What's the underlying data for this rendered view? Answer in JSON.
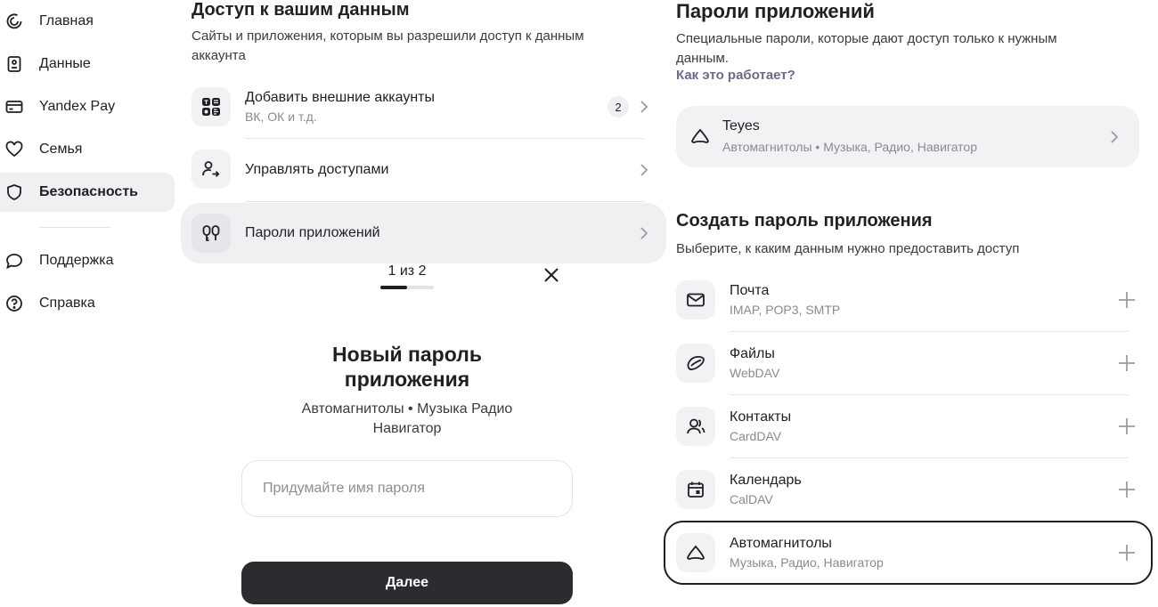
{
  "sidebar": {
    "items": [
      {
        "label": "Главная",
        "icon": "home-icon"
      },
      {
        "label": "Данные",
        "icon": "id-card-icon"
      },
      {
        "label": "Yandex Pay",
        "icon": "credit-card-icon"
      },
      {
        "label": "Семья",
        "icon": "heart-icon"
      },
      {
        "label": "Безопасность",
        "icon": "shield-icon",
        "active": true
      },
      {
        "label": "Поддержка",
        "icon": "chat-icon"
      },
      {
        "label": "Справка",
        "icon": "help-icon"
      }
    ]
  },
  "access": {
    "title": "Доступ к вашим данным",
    "subtitle_line1": "Сайты и приложения, которым вы разрешили доступ к данным",
    "subtitle_line2": "аккаунта",
    "rows": [
      {
        "title": "Добавить внешние аккаунты",
        "subtitle": "ВК, ОК и т.д.",
        "badge": "2",
        "icon": "social-apps-icon"
      },
      {
        "title": "Управлять доступами",
        "icon": "user-access-icon"
      },
      {
        "title": "Пароли приложений",
        "icon": "app-password-icon"
      }
    ]
  },
  "wizard": {
    "step_label": "1 из 2",
    "step_progress": 0.5,
    "title_line1": "Новый пароль",
    "title_line2": "приложения",
    "subtitle_line1": "Автомагнитолы • Музыка Радио",
    "subtitle_line2": "Навигатор",
    "input_placeholder": "Придумайте имя пароля",
    "next_label": "Далее"
  },
  "app_passwords": {
    "title": "Пароли приложений",
    "subtitle_line1": "Специальные пароли, которые дают доступ только к нужным",
    "subtitle_line2": "данным.",
    "how_link": "Как это работает?",
    "existing": {
      "title": "Teyes",
      "subtitle": "Автомагнитолы • Музыка, Радио, Навигатор"
    }
  },
  "create": {
    "title": "Создать пароль приложения",
    "subtitle": "Выберите, к каким данным нужно предоставить доступ",
    "items": [
      {
        "title": "Почта",
        "subtitle": "IMAP, POP3, SMTP",
        "icon": "mail-icon"
      },
      {
        "title": "Файлы",
        "subtitle": "WebDAV",
        "icon": "disk-icon"
      },
      {
        "title": "Контакты",
        "subtitle": "CardDAV",
        "icon": "contacts-icon"
      },
      {
        "title": "Календарь",
        "subtitle": "CalDAV",
        "icon": "calendar-icon"
      },
      {
        "title": "Автомагнитолы",
        "subtitle": "Музыка, Радио, Навигатор",
        "icon": "car-radio-icon",
        "selected": true
      }
    ]
  },
  "colors": {
    "accent_dark": "#2b2b30",
    "link": "#6b6b8a",
    "row_bg": "#f2f2f4"
  }
}
